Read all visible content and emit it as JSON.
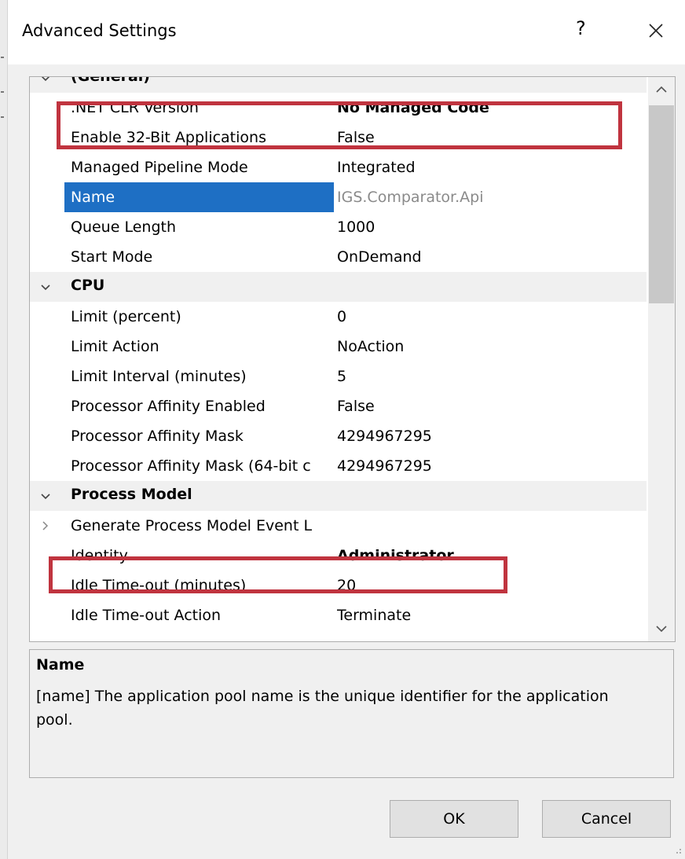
{
  "dialog": {
    "title": "Advanced Settings",
    "help_label": "?",
    "close_icon": "close-icon"
  },
  "grid": {
    "categories": [
      {
        "name": "(General)",
        "properties": [
          {
            "name": ".NET CLR Version",
            "value": "No Managed Code"
          },
          {
            "name": "Enable 32-Bit Applications",
            "value": "False"
          },
          {
            "name": "Managed Pipeline Mode",
            "value": "Integrated"
          },
          {
            "name": "Name",
            "value": "IGS.Comparator.Api"
          },
          {
            "name": "Queue Length",
            "value": "1000"
          },
          {
            "name": "Start Mode",
            "value": "OnDemand"
          }
        ]
      },
      {
        "name": "CPU",
        "properties": [
          {
            "name": "Limit (percent)",
            "value": "0"
          },
          {
            "name": "Limit Action",
            "value": "NoAction"
          },
          {
            "name": "Limit Interval (minutes)",
            "value": "5"
          },
          {
            "name": "Processor Affinity Enabled",
            "value": "False"
          },
          {
            "name": "Processor Affinity Mask",
            "value": "4294967295"
          },
          {
            "name": "Processor Affinity Mask (64-bit c",
            "value": "4294967295"
          }
        ]
      },
      {
        "name": "Process Model",
        "properties": [
          {
            "name": "Generate Process Model Event L",
            "value": ""
          },
          {
            "name": "Identity",
            "value": "Administrator"
          },
          {
            "name": "Idle Time-out (minutes)",
            "value": "20"
          },
          {
            "name": "Idle Time-out Action",
            "value": "Terminate"
          }
        ]
      }
    ],
    "selected_property": "Name",
    "highlighted_properties": [
      ".NET CLR Version",
      "Identity"
    ]
  },
  "description": {
    "title": "Name",
    "text": "[name] The application pool name is the unique identifier for the application pool."
  },
  "buttons": {
    "ok_label": "OK",
    "cancel_label": "Cancel"
  },
  "colors": {
    "selection": "#1e6fc4",
    "highlight_box": "#c0343f",
    "category_background": "#f0f0f0"
  }
}
